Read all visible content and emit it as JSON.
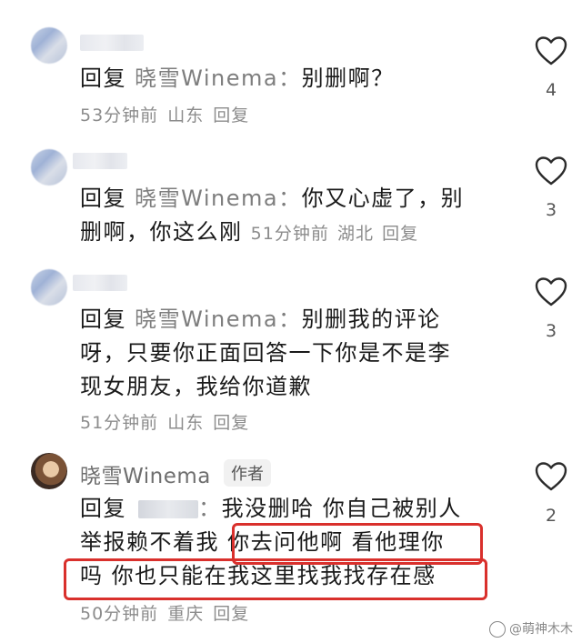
{
  "comments": [
    {
      "reply_kw": "回复",
      "mention": "晓雪Winema",
      "colon": "：",
      "text": "别删啊？",
      "time": "53分钟前",
      "location": "山东",
      "reply_action": "回复",
      "likes": "4"
    },
    {
      "reply_kw": "回复",
      "mention": "晓雪Winema",
      "colon": "：",
      "text_line1": "你又心虚了，别",
      "text_line2": "删啊，你这么刚",
      "time": "51分钟前",
      "location": "湖北",
      "reply_action": "回复",
      "likes": "3"
    },
    {
      "reply_kw": "回复",
      "mention": "晓雪Winema",
      "colon": "：",
      "text_line1": "别删我的评论",
      "text_line2": "呀，只要你正面回答一下你是不是李",
      "text_line3": "现女朋友，我给你道歉",
      "time": "51分钟前",
      "location": "山东",
      "reply_action": "回复",
      "likes": "3"
    },
    {
      "author_name": "晓雪Winema",
      "author_badge": "作者",
      "reply_kw": "回复",
      "colon": "：",
      "text_line1": "我没删哈 你自己被别人",
      "text_line2a": "举报赖不着我",
      "text_line2b": "你去问他啊 看他理你",
      "text_line3": "吗 你也只能在我这里找我找存在感",
      "time": "50分钟前",
      "location": "重庆",
      "reply_action": "回复",
      "likes": "2"
    }
  ],
  "watermark": "@萌神木木",
  "colors": {
    "highlight": "#d9302c",
    "meta": "#8c8c8c",
    "mention": "#7e7e7e"
  },
  "icons": [
    "heart-outline-icon"
  ]
}
